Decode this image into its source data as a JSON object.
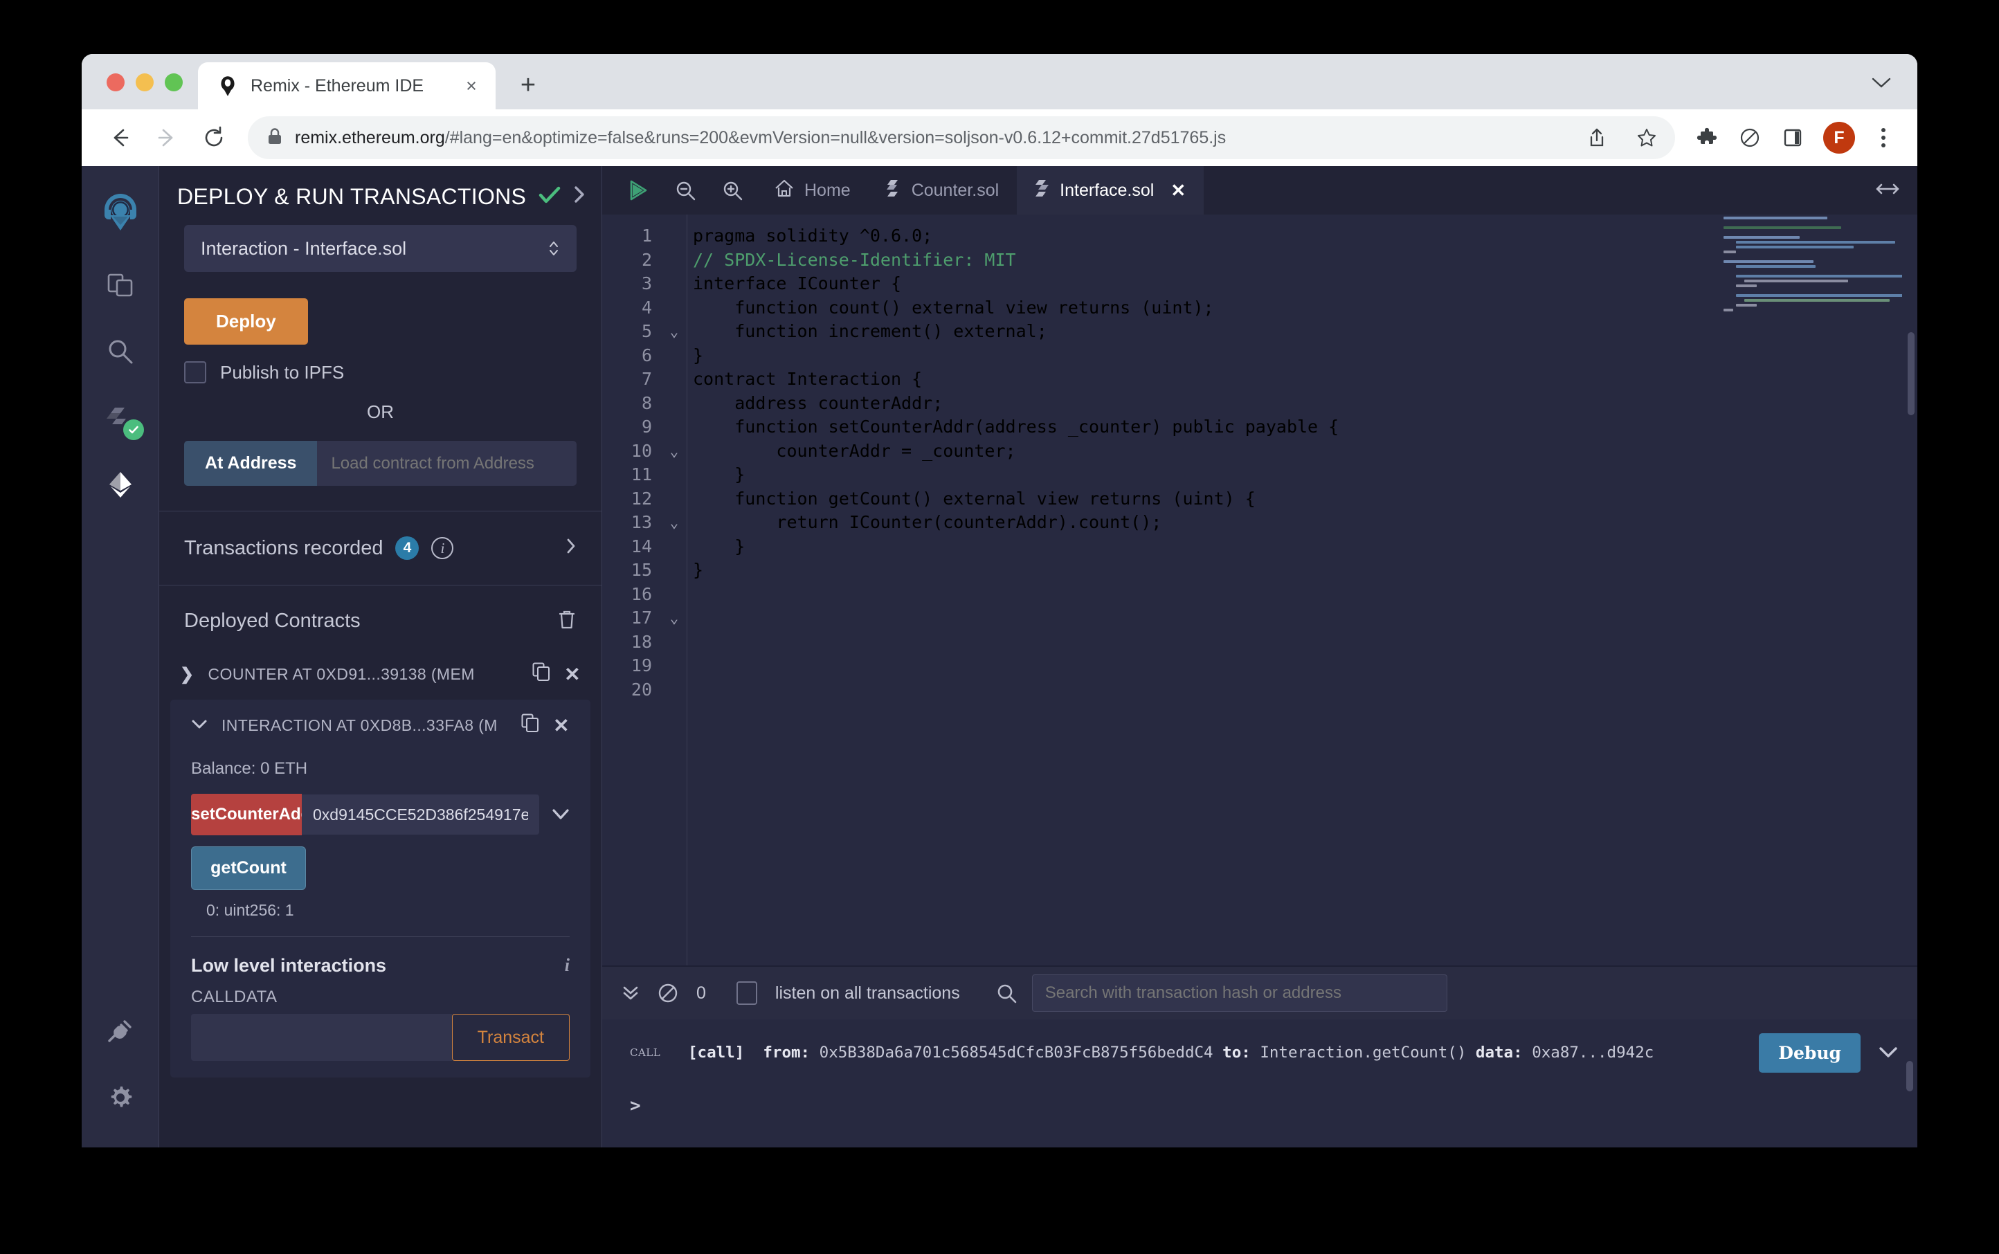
{
  "browser": {
    "tab_title": "Remix - Ethereum IDE",
    "tab_close_label": "×",
    "new_tab_label": "+",
    "url_host": "remix.ethereum.org",
    "url_path": "/#lang=en&optimize=false&runs=200&evmVersion=null&version=soljson-v0.6.12+commit.27d51765.js",
    "profile_initial": "F"
  },
  "panel": {
    "title": "DEPLOY & RUN TRANSACTIONS",
    "env_value": "Interaction - Interface.sol",
    "deploy_label": "Deploy",
    "publish_ipfs_label": "Publish to IPFS",
    "or_label": "OR",
    "at_address_label": "At Address",
    "at_address_placeholder": "Load contract from Address",
    "transactions_recorded_label": "Transactions recorded",
    "transactions_recorded_count": "4",
    "deployed_contracts_label": "Deployed Contracts",
    "contracts": [
      {
        "name": "COUNTER AT 0XD91...39138 (MEM",
        "expanded": false
      },
      {
        "name": "INTERACTION AT 0XD8B...33FA8 (M",
        "expanded": true
      }
    ],
    "balance": "Balance: 0 ETH",
    "set_counter_btn": "setCounterAddr",
    "set_counter_value": "0xd9145CCE52D386f254917e",
    "get_count_btn": "getCount",
    "return_value": "0: uint256: 1",
    "low_level_title": "Low level interactions",
    "calldata_label": "CALLDATA",
    "calldata_value": "",
    "transact_label": "Transact"
  },
  "editor": {
    "tabs": [
      {
        "label": "Home",
        "icon": "home-icon",
        "active": false
      },
      {
        "label": "Counter.sol",
        "icon": "solidity-icon",
        "active": false
      },
      {
        "label": "Interface.sol",
        "icon": "solidity-icon",
        "active": true
      }
    ],
    "line_numbers": [
      "1",
      "2",
      "3",
      "4",
      "5",
      "6",
      "7",
      "8",
      "9",
      "10",
      "11",
      "12",
      "13",
      "14",
      "15",
      "16",
      "17",
      "18",
      "19",
      "20"
    ],
    "fold_markers": [
      "",
      "",
      "",
      "",
      "v",
      "",
      "",
      "",
      "",
      "v",
      "",
      "",
      "v",
      "",
      "",
      "",
      "v",
      "",
      "",
      ""
    ],
    "code_lines": [
      "pragma solidity ^0.6.0;",
      "",
      "// SPDX-License-Identifier: MIT",
      "",
      "interface ICounter {",
      "    function count() external view returns (uint);",
      "    function increment() external;",
      "}",
      "",
      "contract Interaction {",
      "    address counterAddr;",
      "",
      "    function setCounterAddr(address _counter) public payable {",
      "        counterAddr = _counter;",
      "    }",
      "",
      "    function getCount() external view returns (uint) {",
      "        return ICounter(counterAddr).count();",
      "    }",
      "}"
    ]
  },
  "terminal": {
    "pending_count": "0",
    "listen_label": "listen on all transactions",
    "search_placeholder": "Search with transaction hash or address",
    "log": {
      "tag": "CALL",
      "prefix": "[call]",
      "from_label": "from:",
      "from_value": "0x5B38Da6a701c568545dCfcB03FcB875f56beddC4",
      "to_label": "to:",
      "to_value": "Interaction.getCount()",
      "data_label": "data:",
      "data_value": "0xa87...d942c"
    },
    "debug_label": "Debug",
    "prompt": ">"
  },
  "colors": {
    "accent_orange": "#d4843e",
    "accent_blue": "#3a7ba6",
    "accent_red": "#b5413f",
    "success_green": "#4bbd7e",
    "panel_bg": "#222336",
    "editor_bg": "#272940"
  }
}
